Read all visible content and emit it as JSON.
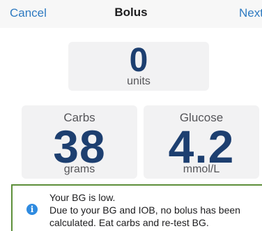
{
  "navbar": {
    "cancel_label": "Cancel",
    "title": "Bolus",
    "next_label": "Next"
  },
  "bolus": {
    "value": "0",
    "unit": "units"
  },
  "carbs": {
    "label": "Carbs",
    "value": "38",
    "unit": "grams"
  },
  "glucose": {
    "label": "Glucose",
    "value": "4.2",
    "unit": "mmol/L"
  },
  "alert": {
    "icon": "info-icon",
    "line1": "Your BG is low.",
    "line2": "Due to your BG and IOB, no bolus has been",
    "line3": "calculated. Eat carbs and re-test BG.",
    "border_color": "#5d8f3a"
  },
  "colors": {
    "accent": "#2e7ac1",
    "value": "#1d3f70",
    "info": "#2f8be0"
  }
}
